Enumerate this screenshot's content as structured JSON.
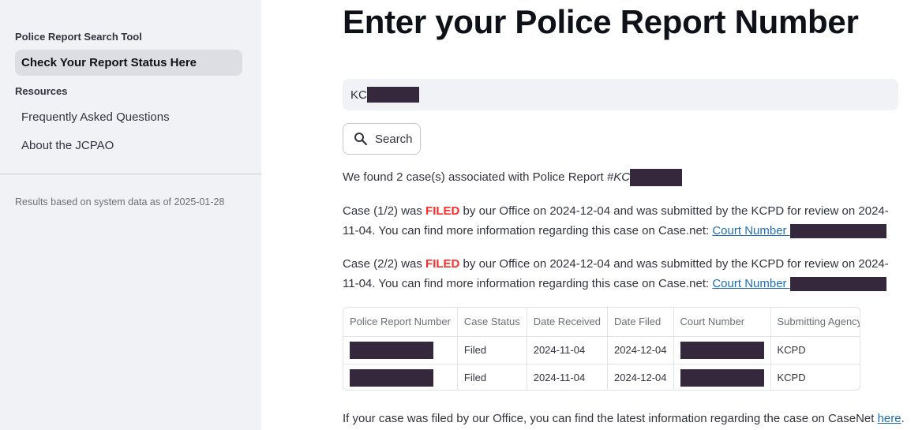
{
  "sidebar": {
    "section1": "Police Report Search Tool",
    "active_item": "Check Your Report Status Here",
    "section2": "Resources",
    "items": [
      "Frequently Asked Questions",
      "About the JCPAO"
    ],
    "note": "Results based on system data as of 2025-01-28"
  },
  "main": {
    "title": "Enter your Police Report Number",
    "search_value": "KC",
    "search_button": "Search",
    "found_text": "We found 2 case(s) associated with Police Report ",
    "found_report_prefix": "#KC",
    "case1": {
      "prefix": "Case (1/2) was ",
      "status": "FILED",
      "middle": " by our Office on 2024-12-04 and was submitted by the KCPD for review on 2024-11-04. You can find more information regarding this case on Case.net: ",
      "link": "Court Number "
    },
    "case2": {
      "prefix": "Case (2/2) was ",
      "status": "FILED",
      "middle": " by our Office on 2024-12-04 and was submitted by the KCPD for review on 2024-11-04. You can find more information regarding this case on Case.net: ",
      "link": "Court Number "
    },
    "table": {
      "headers": [
        "Police Report Number",
        "Case Status",
        "Date Received",
        "Date Filed",
        "Court Number",
        "Submitting Agency"
      ],
      "rows": [
        {
          "status": "Filed",
          "received": "2024-11-04",
          "filed": "2024-12-04",
          "agency": "KCPD"
        },
        {
          "status": "Filed",
          "received": "2024-11-04",
          "filed": "2024-12-04",
          "agency": "KCPD"
        }
      ]
    },
    "footer_text": "If your case was filed by our Office, you can find the latest information regarding the case on CaseNet ",
    "footer_link": "here",
    "footer_end": "."
  },
  "colors": {
    "sidebar_bg": "#f0f2f6",
    "filed": "#ff2b2b",
    "link": "#1f6fb2",
    "redaction": "#35283c"
  }
}
